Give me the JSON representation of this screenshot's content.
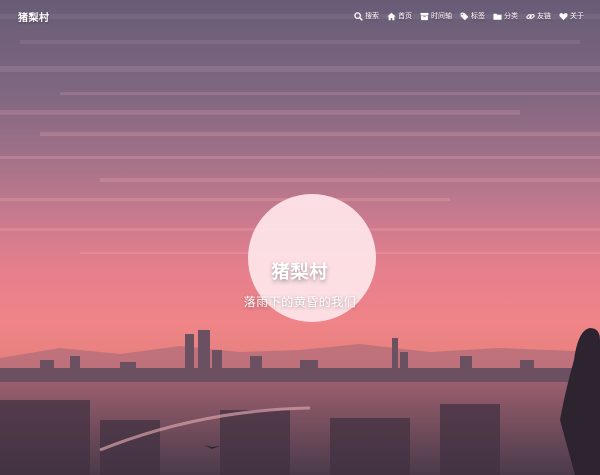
{
  "navbar": {
    "site_name": "猪梨村",
    "menu": [
      {
        "label": "搜索",
        "icon": "search-icon"
      },
      {
        "label": "首页",
        "icon": "home-icon"
      },
      {
        "label": "时间轴",
        "icon": "archive-icon"
      },
      {
        "label": "标签",
        "icon": "tags-icon"
      },
      {
        "label": "分类",
        "icon": "folder-icon"
      },
      {
        "label": "友链",
        "icon": "link-icon"
      },
      {
        "label": "关于",
        "icon": "heart-icon"
      }
    ]
  },
  "hero": {
    "title": "猪梨村",
    "subtitle": "落雨下的黄昏的我们",
    "background": "sunset-city-illustration",
    "colors": {
      "sky_top": "#6b5f7a",
      "sky_mid": "#c27a92",
      "horizon": "#f07f88",
      "sun": "#fde8ea",
      "city": "#5a4a5a"
    }
  }
}
